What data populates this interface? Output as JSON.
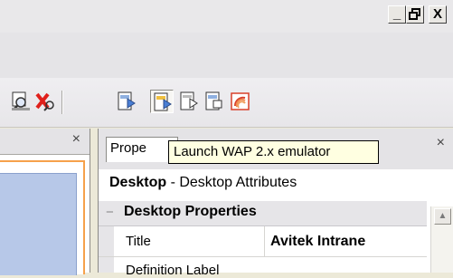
{
  "window": {
    "minimize": "_",
    "restore": "🗗",
    "close": "X"
  },
  "toolbar": {
    "icons": [
      {
        "name": "search-doc-icon"
      },
      {
        "name": "delete-icon"
      },
      {
        "name": "launch-wap1-emulator-icon"
      },
      {
        "name": "launch-wap2-emulator-icon"
      },
      {
        "name": "emulator-icon-3"
      },
      {
        "name": "emulator-icon-4"
      },
      {
        "name": "wireless-icon"
      }
    ]
  },
  "tooltip": "Launch WAP 2.x emulator",
  "left_pane": {
    "close": "×"
  },
  "properties": {
    "tab_label": "Prope",
    "close": "×",
    "title_bold": "Desktop",
    "title_rest": " - Desktop Attributes",
    "category": "Desktop Properties",
    "rows": [
      {
        "name": "Title",
        "value": "Avitek Intrane"
      },
      {
        "name": "Definition Label",
        "value": ""
      }
    ]
  },
  "colors": {
    "tooltip_bg": "#ffffe1",
    "accent_orange": "#f6a14b",
    "selection_blue": "#b7c8e8"
  }
}
